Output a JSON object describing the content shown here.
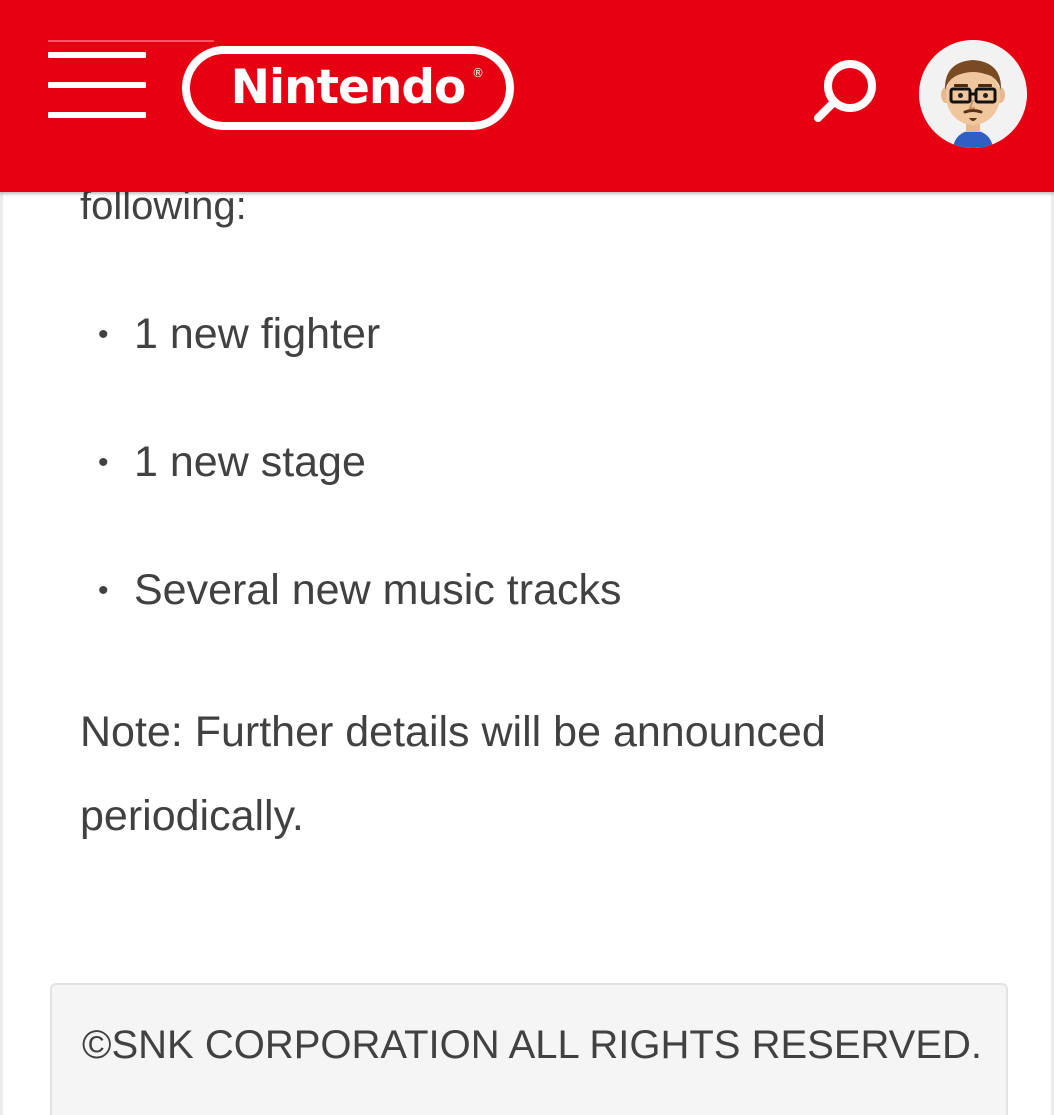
{
  "header": {
    "brand": "Nintendo",
    "registered_mark": "®",
    "background_color": "#e60012",
    "menu_icon": "hamburger-menu-icon",
    "search_icon": "search-icon",
    "avatar_icon": "mii-avatar-icon"
  },
  "article": {
    "cut_line": "following:",
    "bullets": [
      "1 new fighter",
      "1 new stage",
      "Several new music tracks"
    ],
    "note": "Note: Further details will be announced periodically."
  },
  "footer": {
    "copyright": "©SNK CORPORATION ALL RIGHTS RESERVED."
  }
}
